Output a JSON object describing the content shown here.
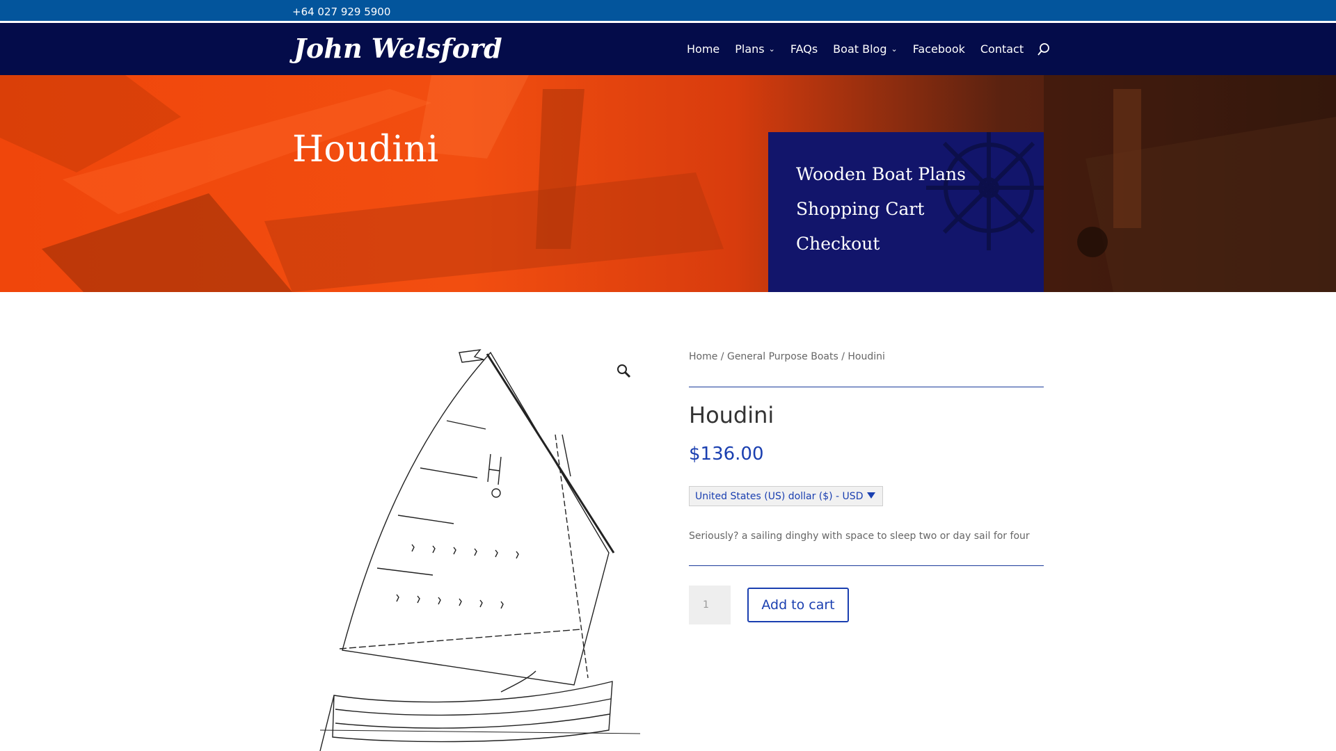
{
  "topbar": {
    "phone": "+64 027 929 5900"
  },
  "header": {
    "logo": "John Welsford",
    "nav": [
      {
        "label": "Home",
        "has_dropdown": false
      },
      {
        "label": "Plans",
        "has_dropdown": true
      },
      {
        "label": "FAQs",
        "has_dropdown": false
      },
      {
        "label": "Boat Blog",
        "has_dropdown": true
      },
      {
        "label": "Facebook",
        "has_dropdown": false
      },
      {
        "label": "Contact",
        "has_dropdown": false
      }
    ],
    "search_icon": "search-icon"
  },
  "hero": {
    "title": "Houdini",
    "links": [
      "Wooden Boat Plans",
      "Shopping Cart",
      "Checkout"
    ]
  },
  "breadcrumb": {
    "items": [
      "Home",
      "General Purpose Boats",
      "Houdini"
    ],
    "separator": " / "
  },
  "product": {
    "title": "Houdini",
    "price": "$136.00",
    "currency": "United States (US) dollar ($) - USD",
    "description": "Seriously? a sailing dinghy with space to sleep two or day sail for four",
    "quantity": "1",
    "add_to_cart": "Add to cart"
  },
  "colors": {
    "topbar": "#03559c",
    "header": "#040c4a",
    "accent": "#1a3fb0",
    "hero_orange": "#f0460b",
    "sidebox": "#12156b"
  }
}
